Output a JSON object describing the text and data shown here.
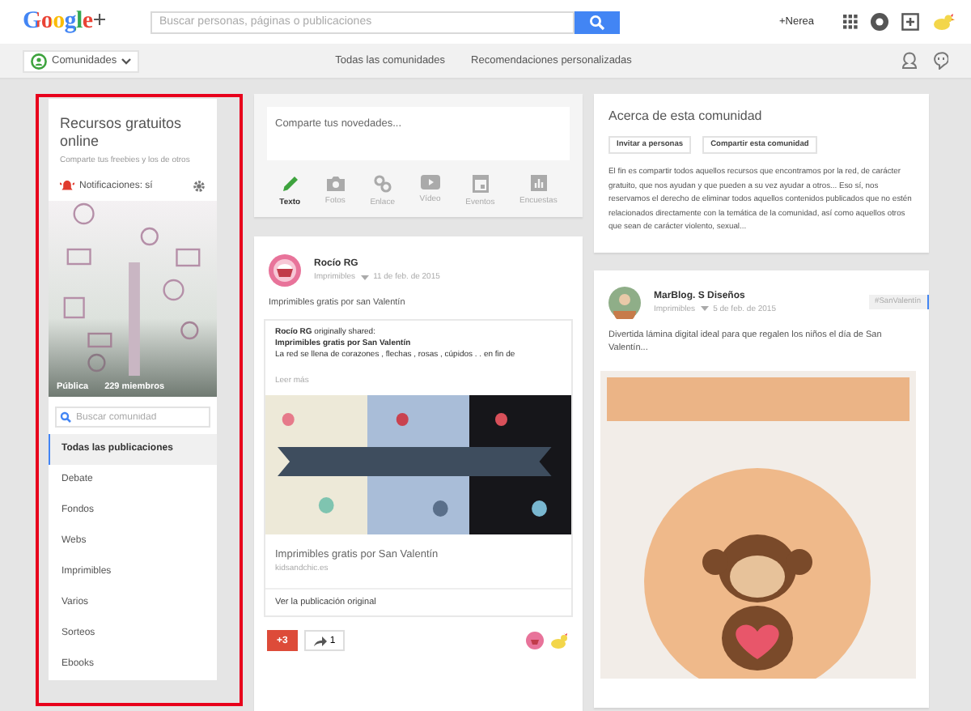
{
  "header": {
    "logo": "Google+",
    "search": {
      "placeholder": "Buscar personas, páginas o publicaciones"
    },
    "user": "+Nerea"
  },
  "nav": {
    "menu": "Comunidades",
    "links": [
      {
        "label": "Todas las comunidades"
      },
      {
        "label": "Recomendaciones personalizadas"
      }
    ]
  },
  "community": {
    "name": "Recursos gratuitos online",
    "tagline": "Comparte tus freebies y los de otros",
    "notifications": "Notificaciones: sí",
    "visibility": "Pública",
    "members": "229 miembros",
    "search": {
      "placeholder": "Buscar comunidad"
    },
    "categories": [
      {
        "label": "Todas las publicaciones",
        "selected": true
      },
      {
        "label": "Debate",
        "selected": false
      },
      {
        "label": "Fondos",
        "selected": false
      },
      {
        "label": "Webs",
        "selected": false
      },
      {
        "label": "Imprimibles",
        "selected": false
      },
      {
        "label": "Varios",
        "selected": false
      },
      {
        "label": "Sorteos",
        "selected": false
      },
      {
        "label": "Ebooks",
        "selected": false
      }
    ]
  },
  "composer": {
    "placeholder": "Comparte tus novedades...",
    "actions": [
      {
        "kind": "text",
        "label": "Texto",
        "selected": true
      },
      {
        "label": "Fotos",
        "selected": false
      },
      {
        "kind": "link",
        "label": "Enlace",
        "selected": false
      },
      {
        "kind": "video",
        "label": "Vídeo",
        "selected": false
      },
      {
        "kind": "event",
        "label": "Eventos",
        "selected": false
      },
      {
        "kind": "poll",
        "label": "Encuestas",
        "selected": false
      }
    ]
  },
  "post": {
    "author": "Rocío RG",
    "category": "Imprimibles",
    "date": "11 de feb. de 2015",
    "text": "Imprimibles gratis por san Valentín",
    "shared": {
      "intro": "**Rocío RG** originally shared:",
      "title": "Imprimibles gratis por San Valentín",
      "excerpt": "La red se llena de corazones , flechas , rosas , cúpidos . . en fin de",
      "more": "Leer más",
      "link_title": "Imprimibles gratis por San Valentín",
      "domain": "kidsandchic.es",
      "original": "Ver la publicación original"
    },
    "plus": "+3",
    "shares": "1"
  },
  "about": {
    "title": "Acerca de esta comunidad",
    "buttons": [
      "Invitar a personas",
      "Compartir esta comunidad"
    ],
    "text": "El fin es compartir todos aquellos recursos que encontramos por la red, de carácter gratuito, que nos ayudan y que pueden a su vez ayudar a otros... Eso sí, nos reservamos el derecho de eliminar todos aquellos contenidos publicados que no estén relacionados directamente con la temática de la comunidad, así como aquellos otros que sean de carácter violento, sexual..."
  },
  "post2": {
    "author": "MarBlog. S Diseños",
    "category": "Imprimibles",
    "date": "5 de feb. de 2015",
    "tag": "#SanValentín",
    "text": "Divertida lámina digital ideal para que regalen los niños el día de San Valentín..."
  }
}
